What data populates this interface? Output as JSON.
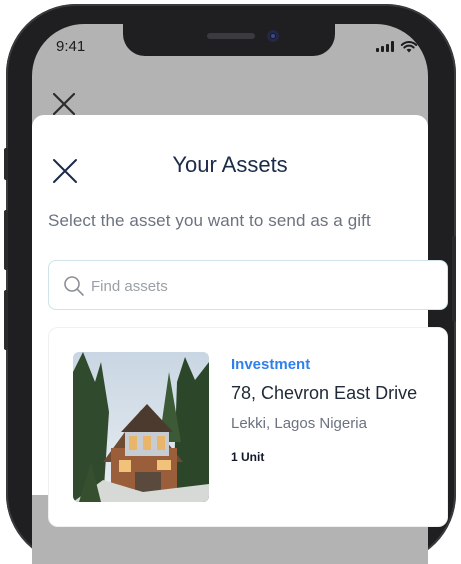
{
  "status_bar": {
    "time": "9:41"
  },
  "sheet": {
    "title": "Your Assets",
    "subtitle": "Select the asset you want to send as a gift"
  },
  "search": {
    "placeholder": "Find assets"
  },
  "assets": [
    {
      "category": "Investment",
      "name": "78, Chevron East Drive",
      "location": "Lekki, Lagos Nigeria",
      "units": "1 Unit"
    }
  ],
  "colors": {
    "accent": "#2f80ed",
    "title": "#1c2b4a",
    "overlay": "#b3b3b3"
  }
}
